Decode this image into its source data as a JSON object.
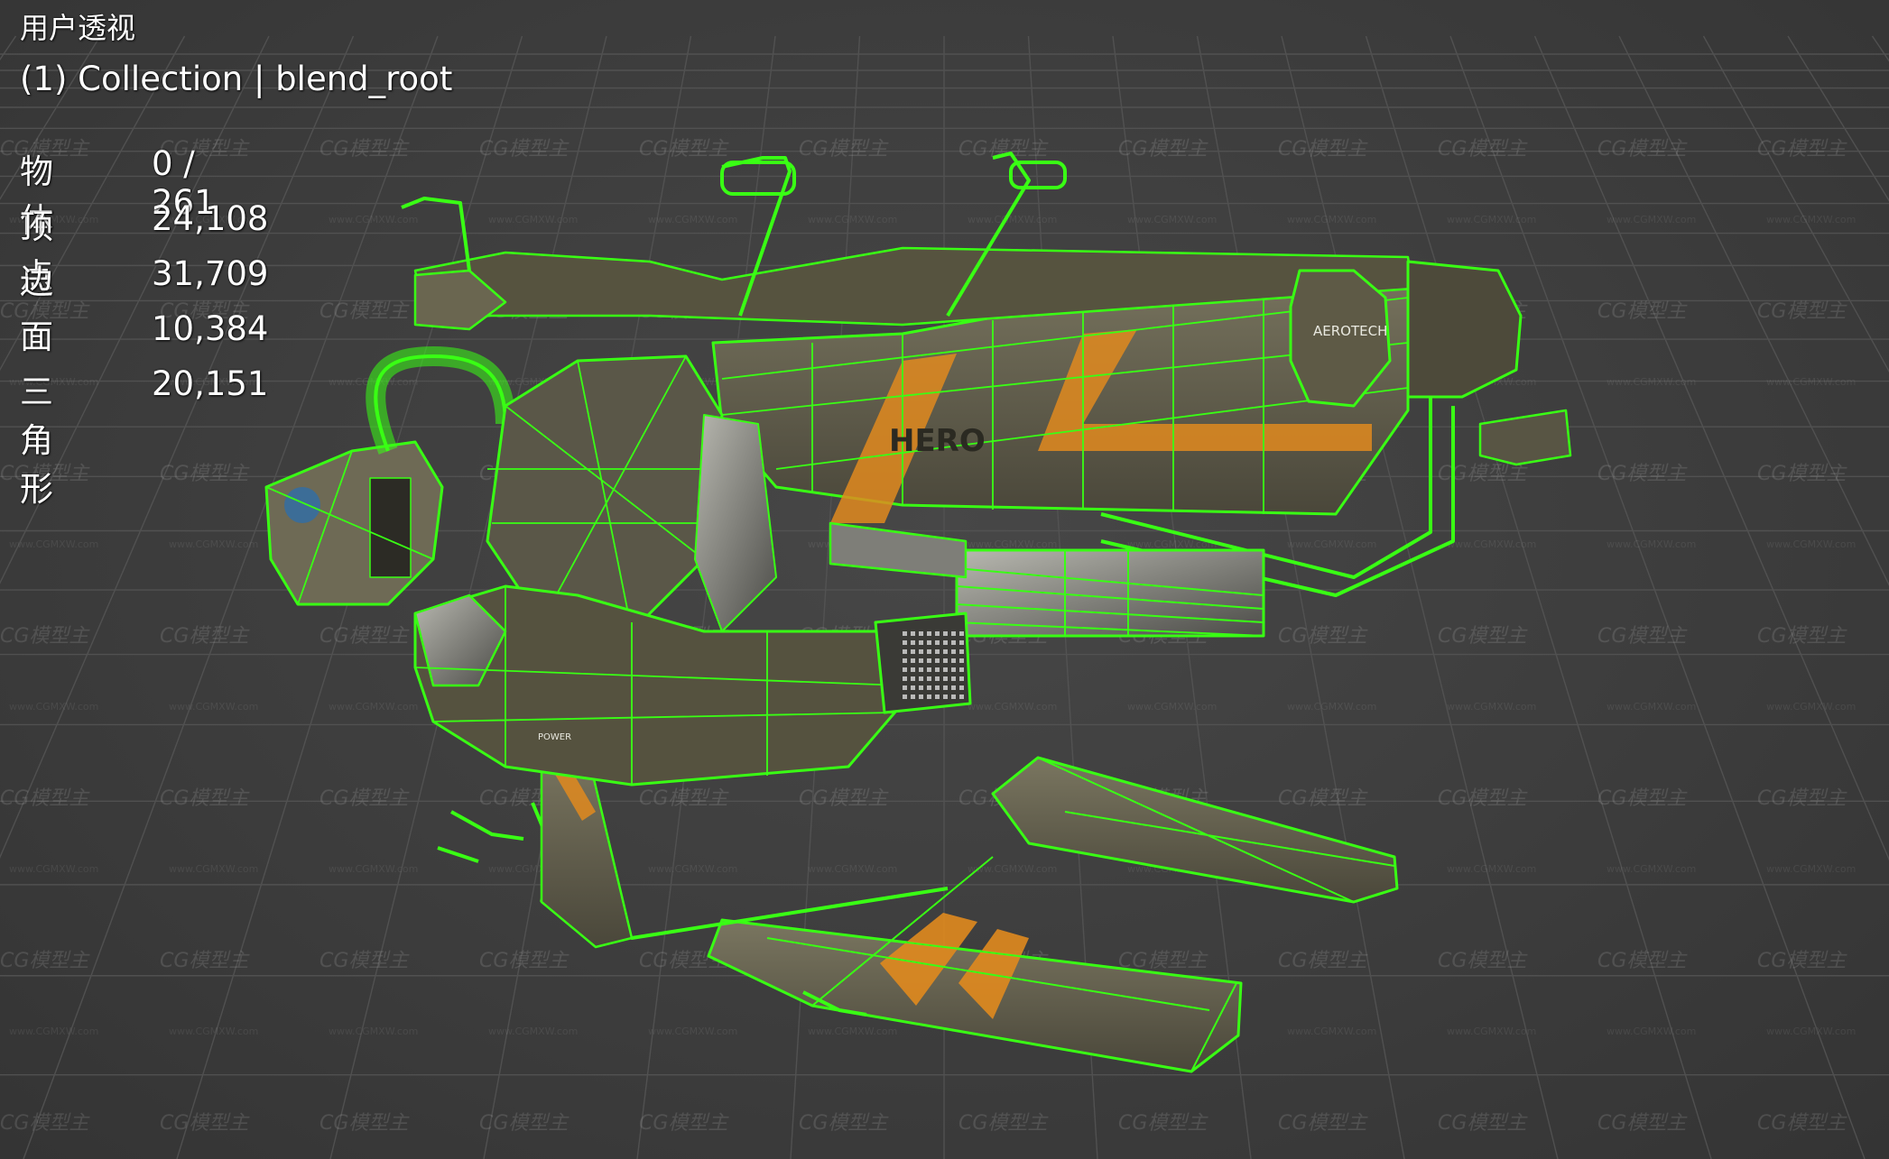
{
  "viewport": {
    "view_name": "用户透视",
    "collection_label": "(1) Collection | blend_root"
  },
  "stats": [
    {
      "label": "物体",
      "value": "0 / 261"
    },
    {
      "label": "顶点",
      "value": "24,108"
    },
    {
      "label": "边",
      "value": "31,709"
    },
    {
      "label": "面",
      "value": "10,384"
    },
    {
      "label": "三角形",
      "value": "20,151"
    }
  ],
  "model": {
    "decal_brand": "AEROTECH",
    "decal_hero": "HERO",
    "decal_power": "POWER"
  },
  "watermark": {
    "text": "CG模型主",
    "url_text": "www.CGMXW.com"
  },
  "colors": {
    "viewport_bg": "#3d3d3d",
    "grid_line": "#555555",
    "wireframe": "#39ff14",
    "hull": "#6a6650",
    "hull_dark": "#3f3d31",
    "stripe": "#e08a1e",
    "metal": "#8a8a84"
  }
}
